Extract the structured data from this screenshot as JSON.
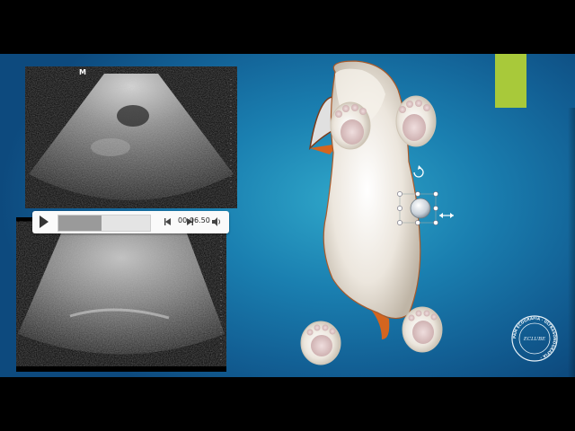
{
  "ultrasound_top": {
    "brand": "M"
  },
  "player": {
    "time": "00:06.50",
    "progress": 0.47
  },
  "colors": {
    "slide_bg": "#1a7fb0",
    "accent_green": "#a8c93a"
  },
  "seal": {
    "text_outer": "PAM ECOGRAFIA · ULTRASONOGRAFIA ·",
    "text_center": "ECLUBE"
  },
  "icons": {
    "play": "play-icon",
    "back": "skip-back-icon",
    "forward": "skip-forward-icon",
    "volume": "volume-icon",
    "rotate": "rotate-handle-icon",
    "resize": "resize-arrow-icon"
  }
}
